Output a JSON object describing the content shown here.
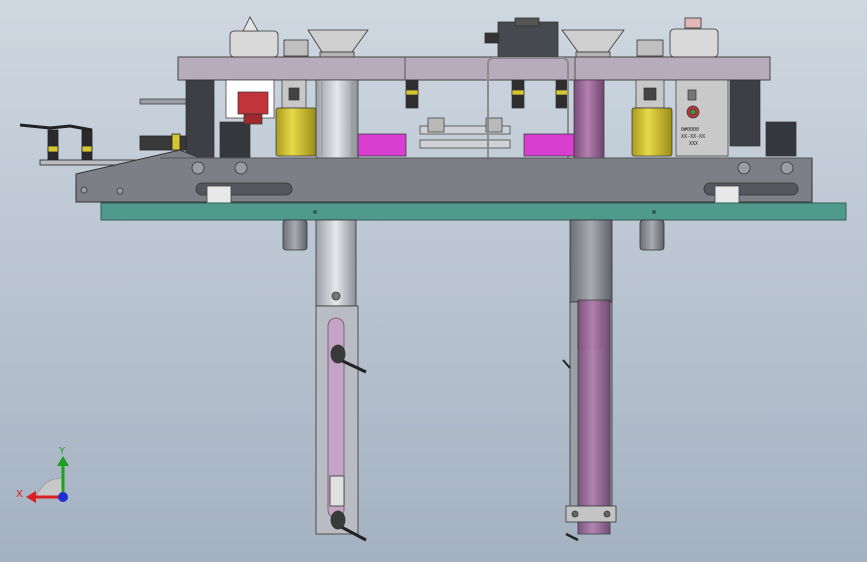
{
  "scene": {
    "type": "cad-mechanical-assembly-front-view",
    "colors": {
      "background_top": "#c9d3dd",
      "background_bottom": "#a9b6c5",
      "top_plate": "#b7acbc",
      "base_plate": "#4f9a8c",
      "side_frame": "#7c7f86",
      "magenta_block": "#d63fcf",
      "yellow_cylinder": "#d6c632",
      "purple_rod": "#a06a9c",
      "red_part": "#c2343a"
    }
  },
  "nameplate": {
    "line1": "0#0000",
    "line2": "XX-XX-XX",
    "line3": "XXX"
  },
  "triad": {
    "x_label": "X",
    "y_label": "Y",
    "x_color": "#d82020",
    "y_color": "#20a020",
    "z_color": "#2030d0"
  }
}
